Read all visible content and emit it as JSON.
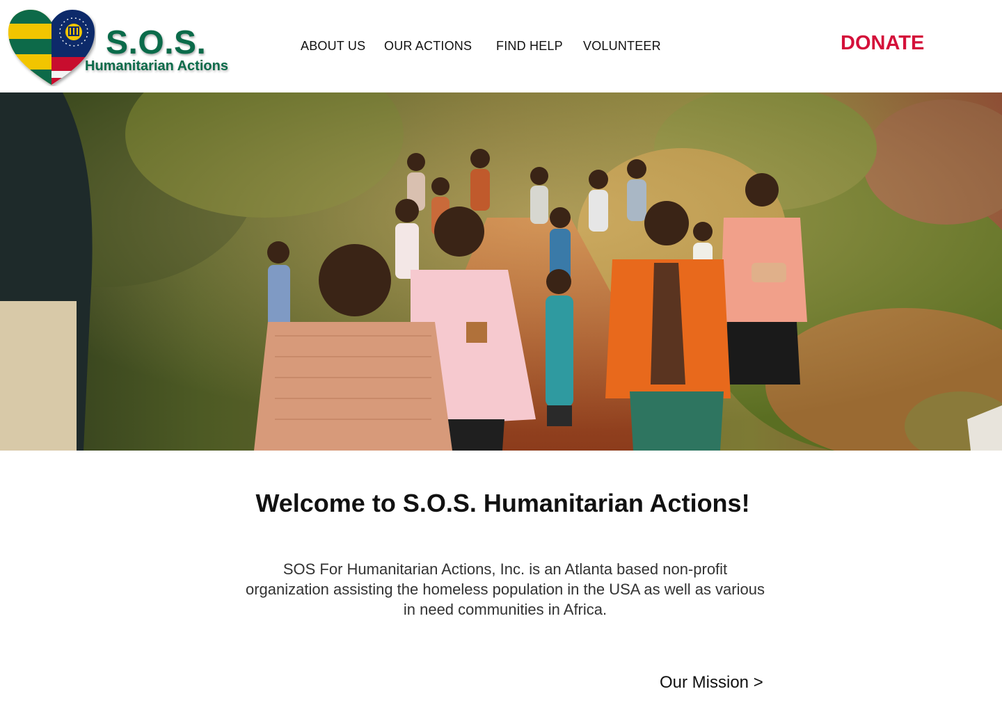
{
  "brand": {
    "title": "S.O.S.",
    "subtitle": "Humanitarian Actions",
    "colors": {
      "green": "#0b6b4a",
      "yellow": "#f2c500",
      "red": "#c8102e",
      "navy": "#0a2a6b"
    }
  },
  "nav": {
    "items": [
      {
        "label": "ABOUT US"
      },
      {
        "label": "OUR ACTIONS"
      },
      {
        "label": "FIND HELP"
      },
      {
        "label": "VOLUNTEER"
      }
    ],
    "donate_label": "DONATE",
    "donate_color": "#d4103a"
  },
  "hero": {
    "image": "children-running-photo"
  },
  "main": {
    "welcome": "Welcome to S.O.S. Humanitarian Actions!",
    "intro": "SOS For Humanitarian Actions, Inc. is an Atlanta based non-profit organization assisting the homeless population in the USA as well as various in need communities in Africa.",
    "mission_link": "Our Mission >"
  }
}
